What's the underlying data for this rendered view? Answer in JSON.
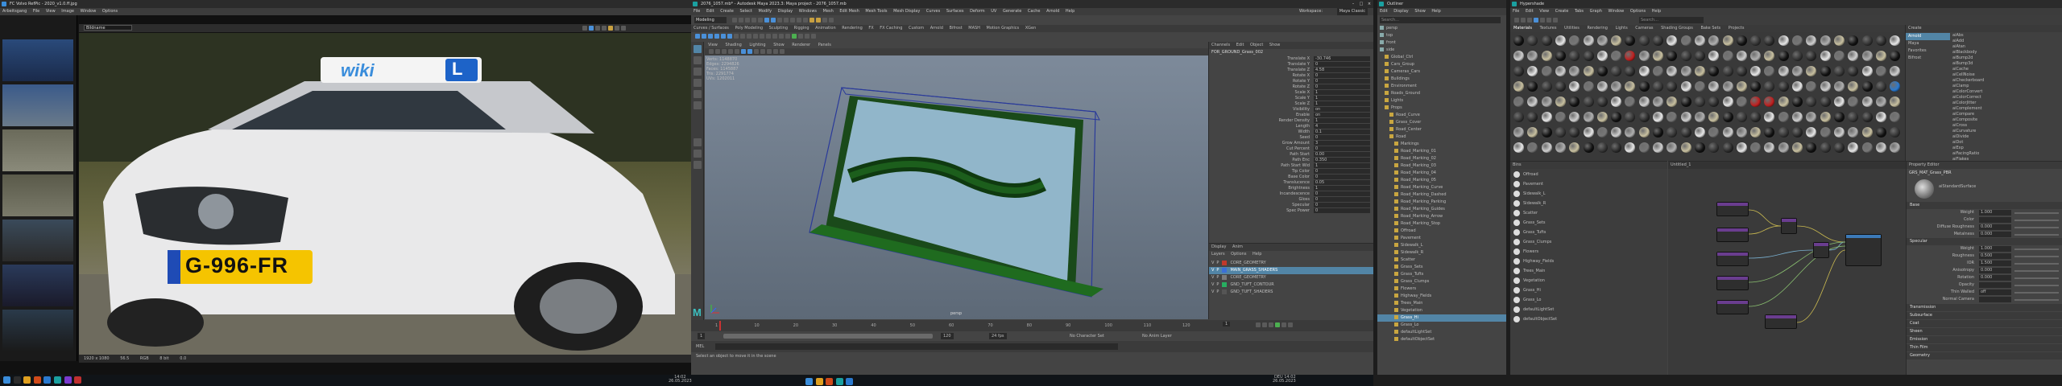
{
  "fcheck": {
    "title": "FC Volvo RefPic - 2020_v1.0.ff.jpg",
    "menu": [
      "Arbeitsgang",
      "File",
      "View",
      "Image",
      "Window",
      "Options"
    ],
    "toolbar_field": "Bildname",
    "plate_text": "G-996-FR",
    "sign_text": "wiki",
    "sign_letter": "L",
    "status_items": [
      "1920 x 1080",
      "56.5",
      "RGB",
      "8 bit",
      "0.0"
    ]
  },
  "maya": {
    "title": "2076_1057.mb* - Autodesk Maya 2023.3: Maya project - 2076_1057.mb",
    "menu": [
      "File",
      "Edit",
      "Create",
      "Select",
      "Modify",
      "Display",
      "Windows",
      "Mesh",
      "Edit Mesh",
      "Mesh Tools",
      "Mesh Display",
      "Curves",
      "Surfaces",
      "Deform",
      "UV",
      "Generate",
      "Cache",
      "Arnold",
      "Help"
    ],
    "workspace_label": "Workspace:",
    "workspace_value": "Maya Classic",
    "mode": "Modeling",
    "shelf_tabs": [
      "Curves / Surfaces",
      "Poly Modeling",
      "Sculpting",
      "Rigging",
      "Animation",
      "Rendering",
      "FX",
      "FX Caching",
      "Custom",
      "Arnold",
      "Bifrost",
      "MASH",
      "Motion Graphics",
      "XGen"
    ],
    "viewport_menu": [
      "View",
      "Shading",
      "Lighting",
      "Show",
      "Renderer",
      "Panels"
    ],
    "hud": [
      {
        "k": "Verts:",
        "v": "1148870"
      },
      {
        "k": "Edges:",
        "v": "2294826"
      },
      {
        "k": "Faces:",
        "v": "1145887"
      },
      {
        "k": "Tris:",
        "v": "2291774"
      },
      {
        "k": "UVs:",
        "v": "1202011"
      }
    ],
    "camera_label": "persp",
    "channel_tabs": [
      "Channels",
      "Edit",
      "Object",
      "Show"
    ],
    "channel_object": "FOR_GROUND_Grass_002",
    "channels": [
      {
        "k": "Translate X",
        "v": "-30.746"
      },
      {
        "k": "Translate Y",
        "v": "0"
      },
      {
        "k": "Translate Z",
        "v": "4.58"
      },
      {
        "k": "Rotate X",
        "v": "0"
      },
      {
        "k": "Rotate Y",
        "v": "0"
      },
      {
        "k": "Rotate Z",
        "v": "0"
      },
      {
        "k": "Scale X",
        "v": "1"
      },
      {
        "k": "Scale Y",
        "v": "1"
      },
      {
        "k": "Scale Z",
        "v": "1"
      },
      {
        "k": "Visibility",
        "v": "on"
      },
      {
        "k": "Enable",
        "v": "on"
      },
      {
        "k": "Render Density",
        "v": "1"
      },
      {
        "k": "Length",
        "v": "4"
      },
      {
        "k": "Width",
        "v": "0.1"
      },
      {
        "k": "Seed",
        "v": "0"
      },
      {
        "k": "Grow Amount",
        "v": "3"
      },
      {
        "k": "Cut Percent",
        "v": "0"
      },
      {
        "k": "Path Start",
        "v": "0.00"
      },
      {
        "k": "Path Enc",
        "v": "0.350"
      },
      {
        "k": "Path Start Wid",
        "v": "1"
      },
      {
        "k": "Tip Color",
        "v": "0"
      },
      {
        "k": "Base Color",
        "v": "0"
      },
      {
        "k": "Translucence",
        "v": "0.05"
      },
      {
        "k": "Brightness",
        "v": "1"
      },
      {
        "k": "Incandescence",
        "v": "0"
      },
      {
        "k": "Gloss",
        "v": "0"
      },
      {
        "k": "Specular",
        "v": "0"
      },
      {
        "k": "Spec Power",
        "v": "0"
      }
    ],
    "layer_tabs": [
      "Display",
      "Anim"
    ],
    "layer_menu": [
      "Layers",
      "Options",
      "Help"
    ],
    "layers": [
      {
        "name": "CORE_GEOMETRY",
        "color": "#c0392b"
      },
      {
        "name": "MAIN_GRASS_SHADERS",
        "color": "#3b6fd8"
      },
      {
        "name": "CORE_GEOMETRY",
        "color": "#7a7a7a"
      },
      {
        "name": "GND_TUFT_CONTOUR",
        "color": "#27ae60"
      },
      {
        "name": "GND_TUFT_SHADERS",
        "color": "#555555"
      }
    ],
    "timeline_ticks": [
      "1",
      "10",
      "20",
      "30",
      "40",
      "50",
      "60",
      "70",
      "80",
      "90",
      "100",
      "110",
      "120"
    ],
    "range_start": "1",
    "range_end": "120",
    "fps": "24 fps",
    "char_set": "No Character Set",
    "anim_layer": "No Anim Layer",
    "current_frame": "1",
    "cmd_label": "MEL",
    "help_line": "Select an object to move it in the scene"
  },
  "outliner": {
    "title": "Outliner",
    "menu": [
      "Edit",
      "Display",
      "Show",
      "Help"
    ],
    "search_placeholder": "Search...",
    "items": [
      "persp",
      "top",
      "front",
      "side",
      "Global_Ctrl",
      "Cars_Group",
      "Cameras_Cars",
      "Buildings",
      "Environment",
      "Roads_Ground",
      "Lights",
      "Props",
      "Road_Curve",
      "Grass_Cover",
      "Road_Center",
      "Road",
      "Markings",
      "Road_Marking_01",
      "Road_Marking_02",
      "Road_Marking_03",
      "Road_Marking_04",
      "Road_Marking_05",
      "Road_Marking_Curve",
      "Road_Marking_Dashed",
      "Road_Marking_Parking",
      "Road_Marking_Guides",
      "Road_Marking_Arrow",
      "Road_Marking_Stop",
      "Offroad",
      "Pavement",
      "Sidewalk_L",
      "Sidewalk_R",
      "Scatter",
      "Grass_Sets",
      "Grass_Tufts",
      "Grass_Clumps",
      "Flowers",
      "Highway_Fields",
      "Trees_Main",
      "Vegetation",
      "Grass_Hi",
      "Grass_Lo",
      "defaultLightSet",
      "defaultObjectSet"
    ],
    "selected_index": 40
  },
  "hypershade": {
    "title": "Hypershade",
    "menu": [
      "File",
      "Edit",
      "View",
      "Create",
      "Tabs",
      "Graph",
      "Window",
      "Options",
      "Help"
    ],
    "browser_tabs": [
      "Materials",
      "Textures",
      "Utilities",
      "Rendering",
      "Lights",
      "Cameras",
      "Shading Groups",
      "Bake Sets",
      "Projects"
    ],
    "search_placeholder": "Search...",
    "create_label": "Create",
    "create_items": [
      "Arnold",
      "Maya",
      "Favorites",
      "Bifrost"
    ],
    "create_list": [
      "aiAbs",
      "aiAdd",
      "aiAtan",
      "aiBlackbody",
      "aiBump2d",
      "aiBump3d",
      "aiCache",
      "aiCellNoise",
      "aiCheckerboard",
      "aiClamp",
      "aiColorConvert",
      "aiColorCorrect",
      "aiColorJitter",
      "aiComplement",
      "aiCompare",
      "aiComposite",
      "aiCross",
      "aiCurvature",
      "aiDivide",
      "aiDot",
      "aiExp",
      "aiFacingRatio",
      "aiFlakes"
    ],
    "bin_label": "Bins",
    "node_editor_label": "Untitled_1",
    "property_title": "Property Editor",
    "material_name": "GRS_MAT_Grass_PBR",
    "material_type": "aiStandardSurface",
    "sections": [
      "Base",
      "Specular",
      "Transmission",
      "Subsurface",
      "Coat",
      "Sheen",
      "Emission",
      "Thin Film",
      "Geometry"
    ],
    "props": [
      {
        "k": "Weight",
        "v": "1.000"
      },
      {
        "k": "Color",
        "v": ""
      },
      {
        "k": "Diffuse Roughness",
        "v": "0.000"
      },
      {
        "k": "Metalness",
        "v": "0.000"
      },
      {
        "k": "Weight",
        "v": "1.000"
      },
      {
        "k": "Roughness",
        "v": "0.500"
      },
      {
        "k": "IOR",
        "v": "1.500"
      },
      {
        "k": "Anisotropy",
        "v": "0.000"
      },
      {
        "k": "Rotation",
        "v": "0.000"
      },
      {
        "k": "Opacity",
        "v": ""
      },
      {
        "k": "Thin Walled",
        "v": "off"
      },
      {
        "k": "Normal Camera",
        "v": ""
      }
    ]
  },
  "taskbar": {
    "left_time": "14:02",
    "left_date": "26.05.2023",
    "right_time": "14:02",
    "right_date": "26.05.2023",
    "lang": "DEU"
  }
}
